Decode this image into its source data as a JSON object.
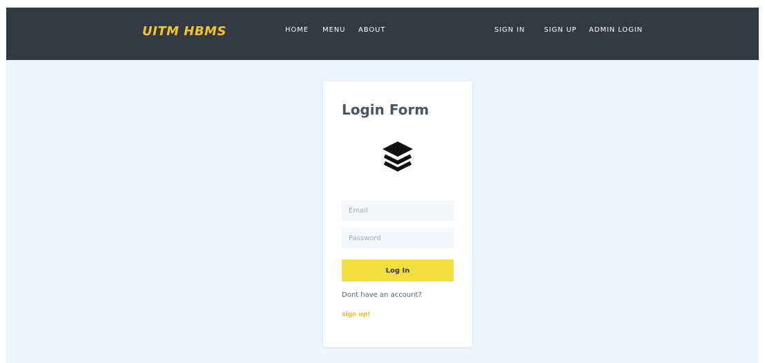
{
  "navbar": {
    "brand": "UITM HBMS",
    "links_left": {
      "home": "HOME",
      "menu": "MENU",
      "about": "ABOUT"
    },
    "links_right": {
      "sign_in": "SIGN IN",
      "sign_up": "SIGN UP",
      "admin_login": "ADMIN LOGIN"
    }
  },
  "login_form": {
    "title": "Login Form",
    "icon": "layers-icon",
    "email_placeholder": "Email",
    "password_placeholder": "Password",
    "submit_label": "Log In",
    "no_account_text": "Dont have an account?",
    "signup_link": "sign up!"
  },
  "colors": {
    "navbar_bg": "#343a42",
    "brand": "#f2c52a",
    "page_bg": "#eff5fe",
    "button_bg": "#f2df3d",
    "link": "#f0be22"
  }
}
